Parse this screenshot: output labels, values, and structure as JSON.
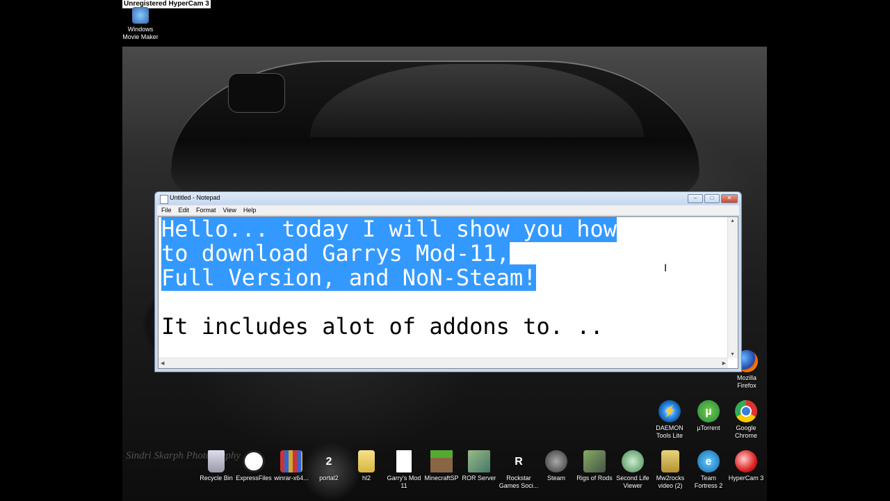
{
  "recorder_banner": "Unregistered HyperCam 3",
  "notepad": {
    "title": "Untitled - Notepad",
    "menu": [
      "File",
      "Edit",
      "Format",
      "View",
      "Help"
    ],
    "lines": {
      "selected_1": "Hello... today I will show you how",
      "selected_2": "to download Garrys Mod-11,",
      "selected_3": "Full Version, and NoN-Steam!",
      "plain_5": "It includes alot of addons to. .."
    }
  },
  "wallpaper_watermark": "Sindri Skarph Photography",
  "desktop_icons": {
    "top_left": {
      "line1": "Windows",
      "line2": "Movie Maker"
    },
    "right": [
      {
        "line1": "Mozilla",
        "line2": "Firefox"
      },
      {
        "line1": "DAEMON",
        "line2": "Tools Lite"
      },
      {
        "line1": "µTorrent",
        "line2": ""
      },
      {
        "line1": "Google",
        "line2": "Chrome"
      }
    ],
    "bottom": [
      {
        "line1": "Recycle Bin",
        "line2": ""
      },
      {
        "line1": "ExpressFiles",
        "line2": ""
      },
      {
        "line1": "winrar-x64...",
        "line2": ""
      },
      {
        "line1": "portal2",
        "line2": ""
      },
      {
        "line1": "hl2",
        "line2": ""
      },
      {
        "line1": "Garry's Mod",
        "line2": "11"
      },
      {
        "line1": "MinecraftSP",
        "line2": ""
      },
      {
        "line1": "ROR Server",
        "line2": ""
      },
      {
        "line1": "Rockstar",
        "line2": "Games Soci..."
      },
      {
        "line1": "Steam",
        "line2": ""
      },
      {
        "line1": "Rigs of Rods",
        "line2": ""
      },
      {
        "line1": "Second Life",
        "line2": "Viewer"
      },
      {
        "line1": "Mw2rocks",
        "line2": "video (2)"
      },
      {
        "line1": "Team",
        "line2": "Fortress 2"
      },
      {
        "line1": "HyperCam 3",
        "line2": ""
      }
    ]
  }
}
